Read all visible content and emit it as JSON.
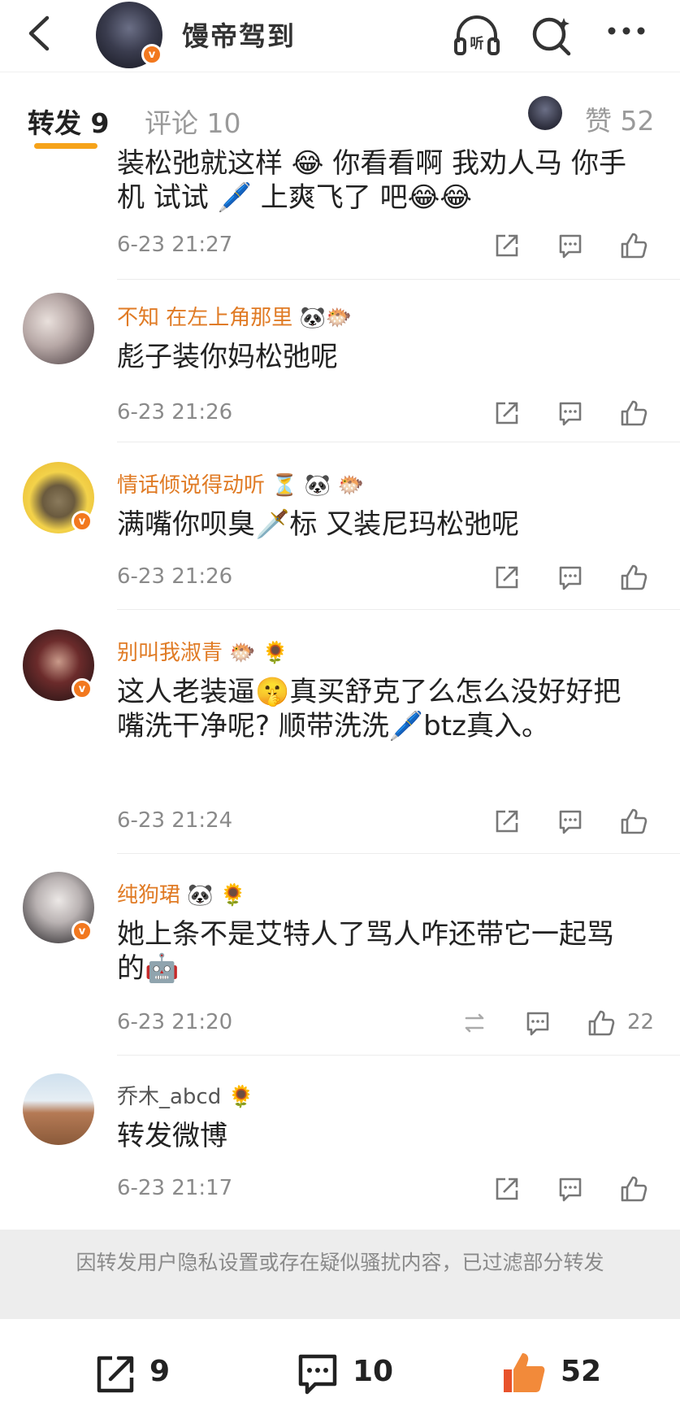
{
  "header": {
    "title": "馒帝驾到",
    "listen_label": "听",
    "vip_badge": "v"
  },
  "tabs": {
    "repost": "转发 9",
    "comment": "评论 10",
    "likes": "赞 52"
  },
  "items": [
    {
      "name": "",
      "text": "装松弛就这样 😂 你看看啊 我劝人马 你手机 试试 🖊️ 上爽飞了 吧😂😂",
      "time": "6-23 21:27",
      "like_count": ""
    },
    {
      "name": "不知 在左上角那里 🐼🐡",
      "text": "彪子装你妈松弛呢",
      "time": "6-23 21:26",
      "like_count": ""
    },
    {
      "name": "情话倾说得动听 ⏳ 🐼 🐡",
      "text": "满嘴你呗臭🗡️标 又装尼玛松弛呢",
      "time": "6-23 21:26",
      "like_count": ""
    },
    {
      "name": "别叫我淑青 🐡 🌻",
      "text": "这人老装逼🤫真买舒克了么怎么没好好把嘴洗干净呢? 顺带洗洗🖊️btz真入。",
      "time": "6-23 21:24",
      "like_count": ""
    },
    {
      "name": "纯狗珺 🐼 🌻",
      "text": "她上条不是艾特人了骂人咋还带它一起骂的🤖",
      "time": "6-23 21:20",
      "like_count": "22"
    },
    {
      "name": "乔木_abcd 🌻",
      "text": "转发微博",
      "time": "6-23 21:17",
      "like_count": ""
    }
  ],
  "notice": "因转发用户隐私设置或存在疑似骚扰内容，已过滤部分转发",
  "bottom": {
    "repost_count": "9",
    "comment_count": "10",
    "like_count": "52"
  },
  "colors": {
    "accent": "#f6a31a",
    "username": "#e07b25",
    "like_active": "#f0772b"
  },
  "icons": [
    "back-icon",
    "listen-icon",
    "search-icon",
    "more-icon",
    "repost-icon",
    "comment-icon",
    "like-icon"
  ]
}
